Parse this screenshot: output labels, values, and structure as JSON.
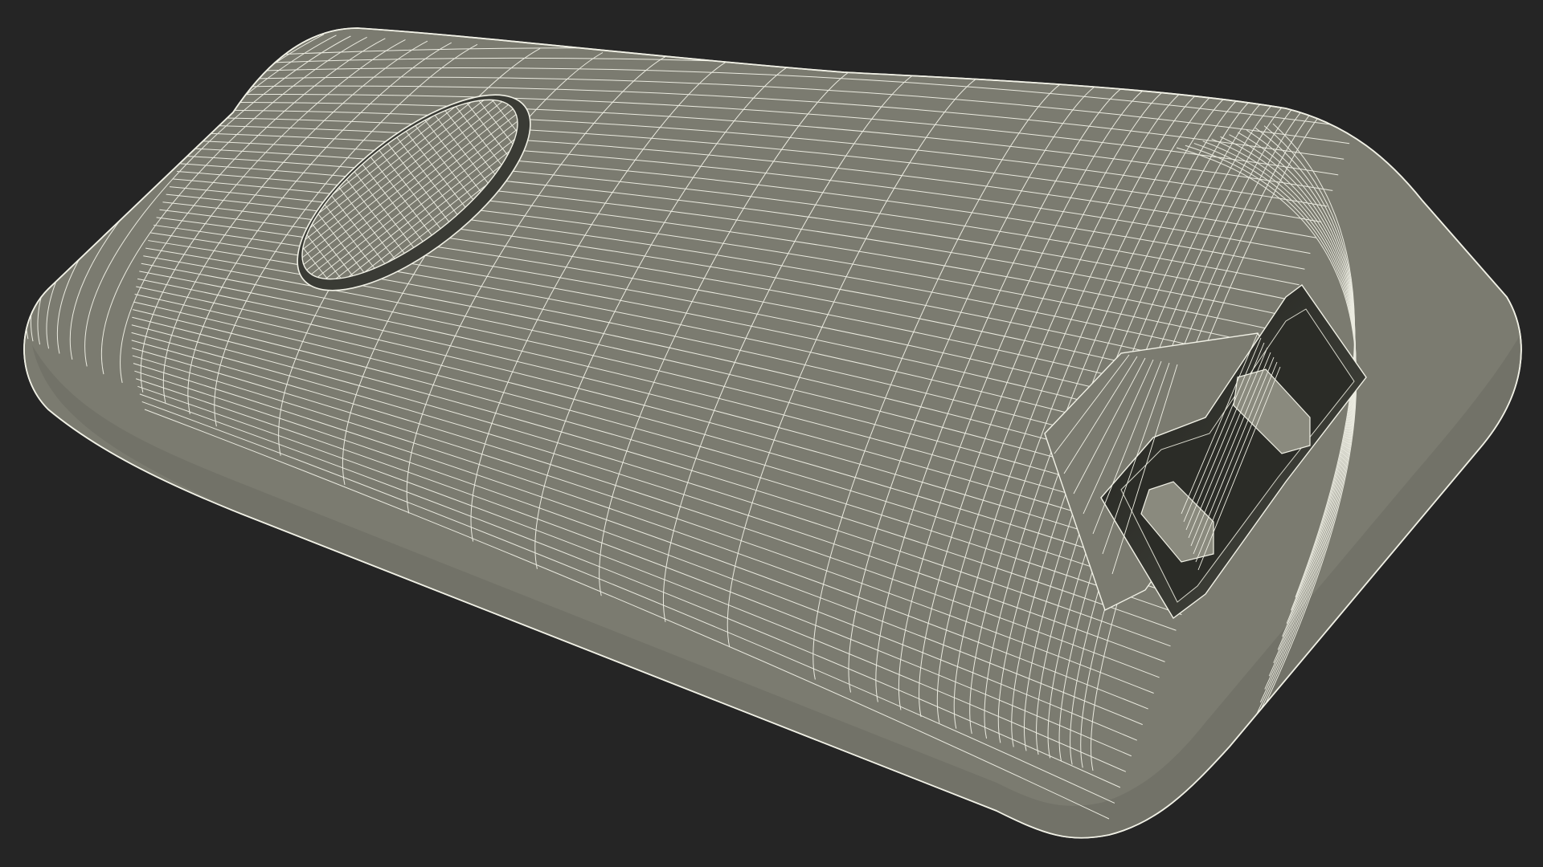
{
  "scene": {
    "subject": "",
    "render_style": "wireframe-over-shaded",
    "colors": {
      "background": "#252525",
      "surface": "#7b7b70",
      "surface_dark": "#6e6e64",
      "wire": "#f1f1e6",
      "cavity": "#3a3b35",
      "cavity_deep": "#22231f"
    }
  }
}
